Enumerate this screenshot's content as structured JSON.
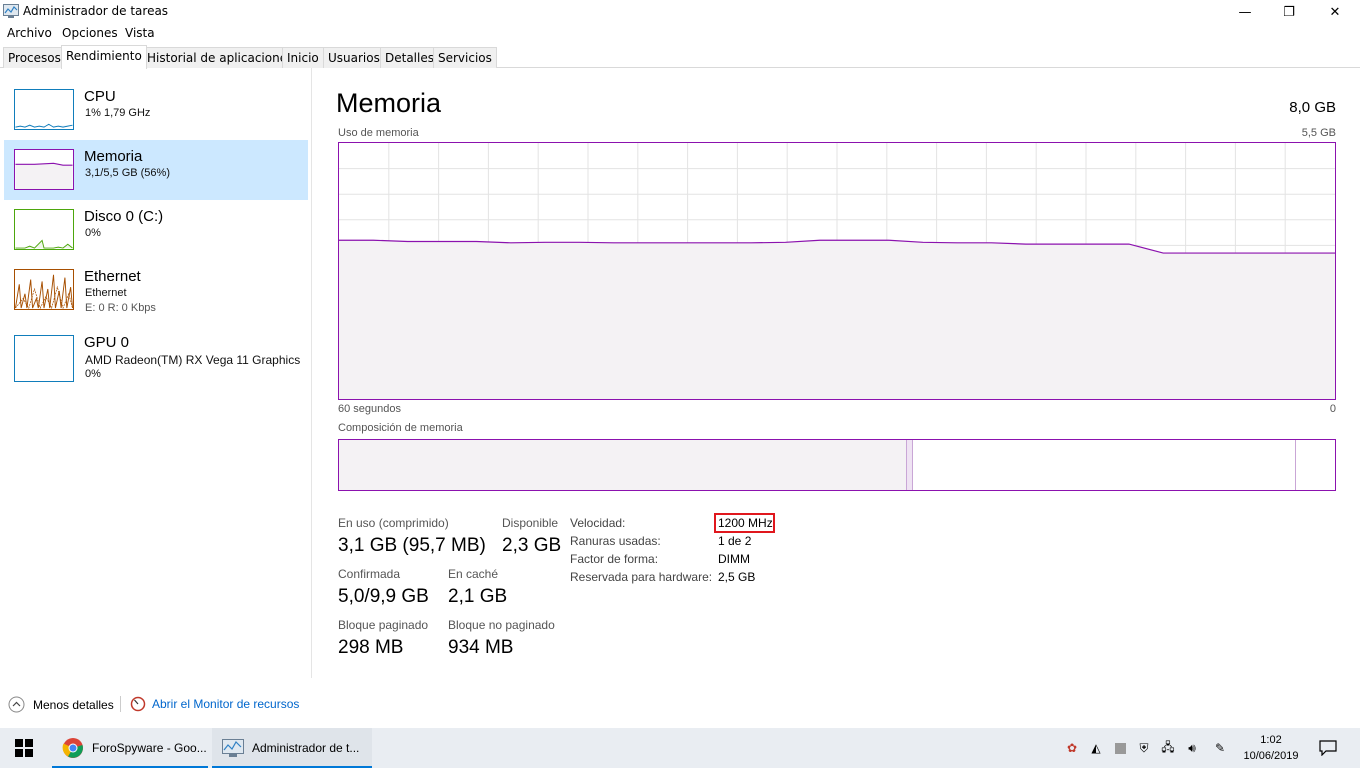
{
  "window": {
    "title": "Administrador de tareas",
    "minimize": "—",
    "maximize": "❐",
    "close": "✕"
  },
  "menu": [
    "Archivo",
    "Opciones",
    "Vista"
  ],
  "tabs": [
    "Procesos",
    "Rendimiento",
    "Historial de aplicaciones",
    "Inicio",
    "Usuarios",
    "Detalles",
    "Servicios"
  ],
  "active_tab": "Rendimiento",
  "sidebar": {
    "items": [
      {
        "name": "CPU",
        "line1": "1%  1,79 GHz",
        "line2": "",
        "color": "#117dbb"
      },
      {
        "name": "Memoria",
        "line1": "3,1/5,5 GB (56%)",
        "line2": "",
        "color": "#8b12ae"
      },
      {
        "name": "Disco 0 (C:)",
        "line1": "0%",
        "line2": "",
        "color": "#4da60c"
      },
      {
        "name": "Ethernet",
        "line1": "Ethernet",
        "line2": "E: 0  R: 0 Kbps",
        "color": "#a74f01"
      },
      {
        "name": "GPU 0",
        "line1": "AMD Radeon(TM) RX Vega 11 Graphics",
        "line2": "0%",
        "color": "#117dbb"
      }
    ]
  },
  "main": {
    "title": "Memoria",
    "total": "8,0 GB",
    "usage_label": "Uso de memoria",
    "usage_max": "5,5 GB",
    "time_left": "60 segundos",
    "time_right": "0",
    "composition_label": "Composición de memoria",
    "usage_fraction_history": [
      0.62,
      0.62,
      0.615,
      0.615,
      0.615,
      0.61,
      0.612,
      0.612,
      0.61,
      0.61,
      0.61,
      0.61,
      0.61,
      0.612,
      0.62,
      0.62,
      0.62,
      0.612,
      0.61,
      0.61,
      0.605,
      0.605,
      0.605,
      0.605,
      0.57,
      0.57,
      0.57,
      0.57,
      0.57,
      0.57
    ],
    "composition": {
      "in_use_fraction": 0.57,
      "modified_fraction": 0.006,
      "standby_fraction": 0.385
    },
    "stats": {
      "in_use_label": "En uso (comprimido)",
      "in_use_value": "3,1 GB (95,7 MB)",
      "available_label": "Disponible",
      "available_value": "2,3 GB",
      "committed_label": "Confirmada",
      "committed_value": "5,0/9,9 GB",
      "cached_label": "En caché",
      "cached_value": "2,1 GB",
      "paged_label": "Bloque paginado",
      "paged_value": "298 MB",
      "nonpaged_label": "Bloque no paginado",
      "nonpaged_value": "934 MB"
    },
    "props": {
      "speed_label": "Velocidad:",
      "speed_value": "1200 MHz",
      "slots_label": "Ranuras usadas:",
      "slots_value": "1 de 2",
      "form_label": "Factor de forma:",
      "form_value": "DIMM",
      "reserved_label": "Reservada para hardware:",
      "reserved_value": "2,5 GB"
    }
  },
  "footer": {
    "less_details": "Menos detalles",
    "resource_monitor": "Abrir el Monitor de recursos"
  },
  "taskbar": {
    "apps": [
      {
        "label": "ForoSpyware - Goo..."
      },
      {
        "label": "Administrador de t..."
      }
    ],
    "time": "1:02",
    "date": "10/06/2019"
  },
  "colors": {
    "memory": "#8b12ae",
    "memory_fill": "#f4f2f4",
    "grid": "#e3e3e3",
    "highlight": "#e0171d",
    "selected": "#cce8ff"
  }
}
